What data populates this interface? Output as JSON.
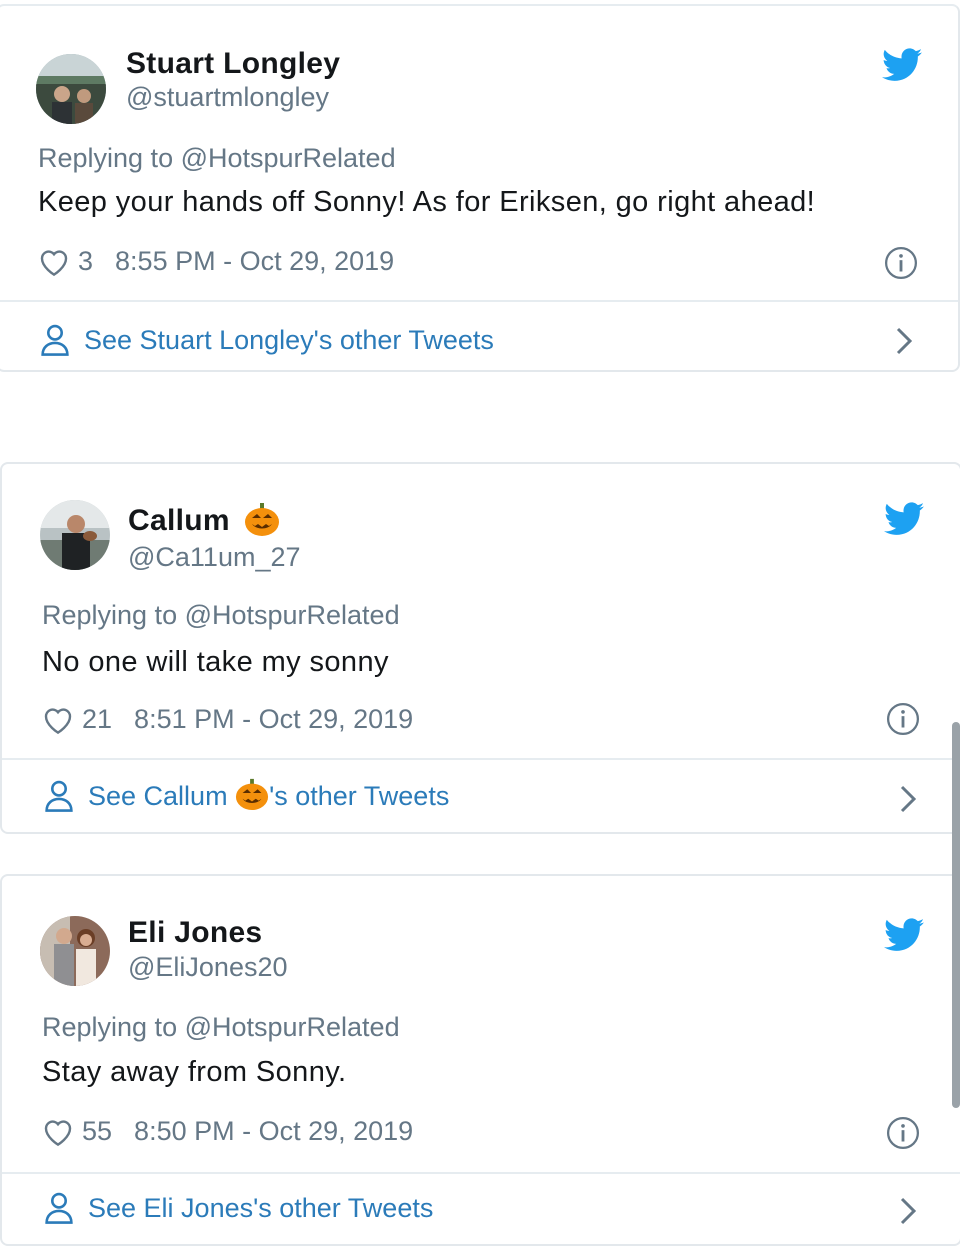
{
  "colors": {
    "accent": "#1da1f2",
    "link": "#2b7bb9",
    "text": "#14171a",
    "muted": "#657786",
    "border": "#e6ecf0"
  },
  "tweets": [
    {
      "name": "Stuart Longley",
      "handle": "@stuartmlongley",
      "replying": "Replying to @HotspurRelated",
      "text": "Keep your hands off Sonny! As for Eriksen, go right ahead!",
      "likes": "3",
      "time": "8:55 PM - Oct 29, 2019",
      "other": "See Stuart Longley's other Tweets",
      "icons": [
        "twitter-bird-icon",
        "heart-icon",
        "info-icon",
        "person-icon",
        "chevron-right-icon"
      ]
    },
    {
      "name": "Callum",
      "handle": "@Ca11um_27",
      "replying": "Replying to @HotspurRelated",
      "text": "No one will take my sonny",
      "likes": "21",
      "time": "8:51 PM - Oct 29, 2019",
      "other_prefix": "See Callum ",
      "other_suffix": "'s other Tweets",
      "name_emoji": "jack-o-lantern-icon"
    },
    {
      "name": "Eli Jones",
      "handle": "@EliJones20",
      "replying": "Replying to @HotspurRelated",
      "text": "Stay away from Sonny.",
      "likes": "55",
      "time": "8:50 PM - Oct 29, 2019",
      "other": "See Eli Jones's other Tweets"
    }
  ]
}
